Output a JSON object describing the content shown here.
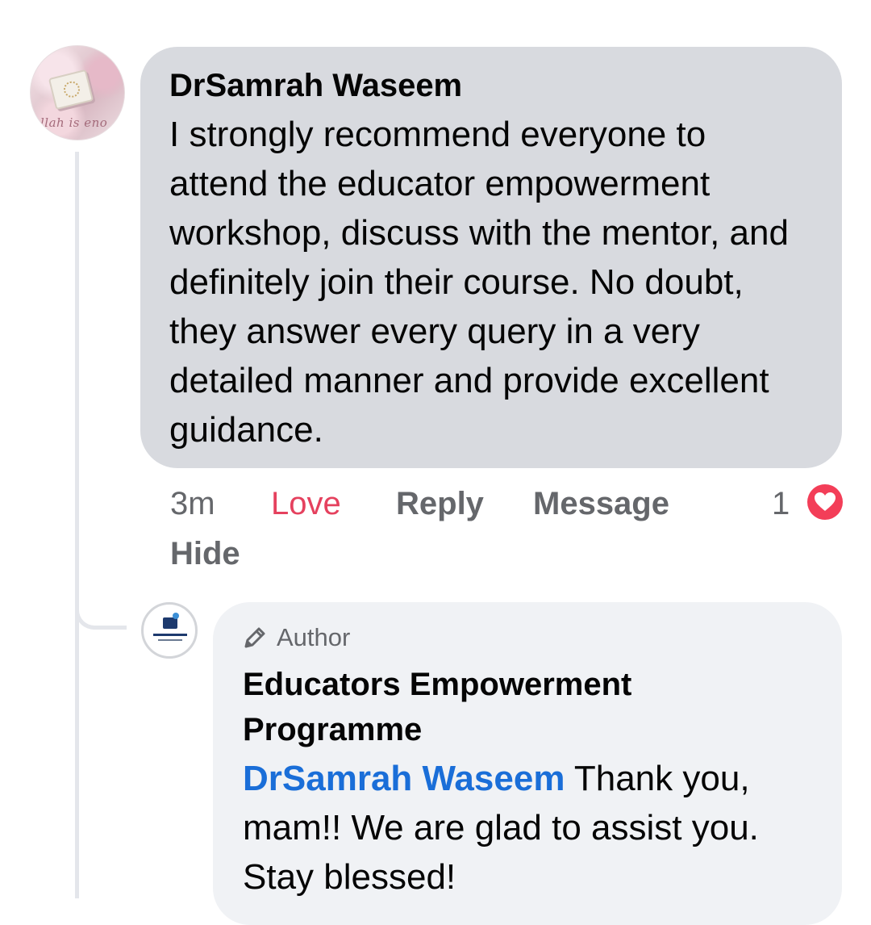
{
  "comment": {
    "author": "DrSamrah Waseem",
    "text": "I strongly recommend everyone to attend the educator empowerment workshop, discuss with the mentor, and definitely join their course. No doubt, they answer every query in a very detailed manner and provide excellent guidance.",
    "avatar_caption": "llah is eno",
    "actions": {
      "time": "3m",
      "love": "Love",
      "reply": "Reply",
      "message": "Message",
      "reaction_count": "1",
      "hide": "Hide"
    },
    "reaction_icon": "heart-icon"
  },
  "reply": {
    "badge": "Author",
    "badge_icon": "pencil-icon",
    "author": "Educators Empowerment Programme",
    "mention": "DrSamrah Waseem",
    "text": " Thank you, mam!! We are glad to assist you. Stay blessed!"
  },
  "colors": {
    "bubble_main": "#d8dadf",
    "bubble_reply": "#f0f2f5",
    "love_active": "#e5415e",
    "mention": "#1a6ed8",
    "heart": "#f33e58"
  }
}
